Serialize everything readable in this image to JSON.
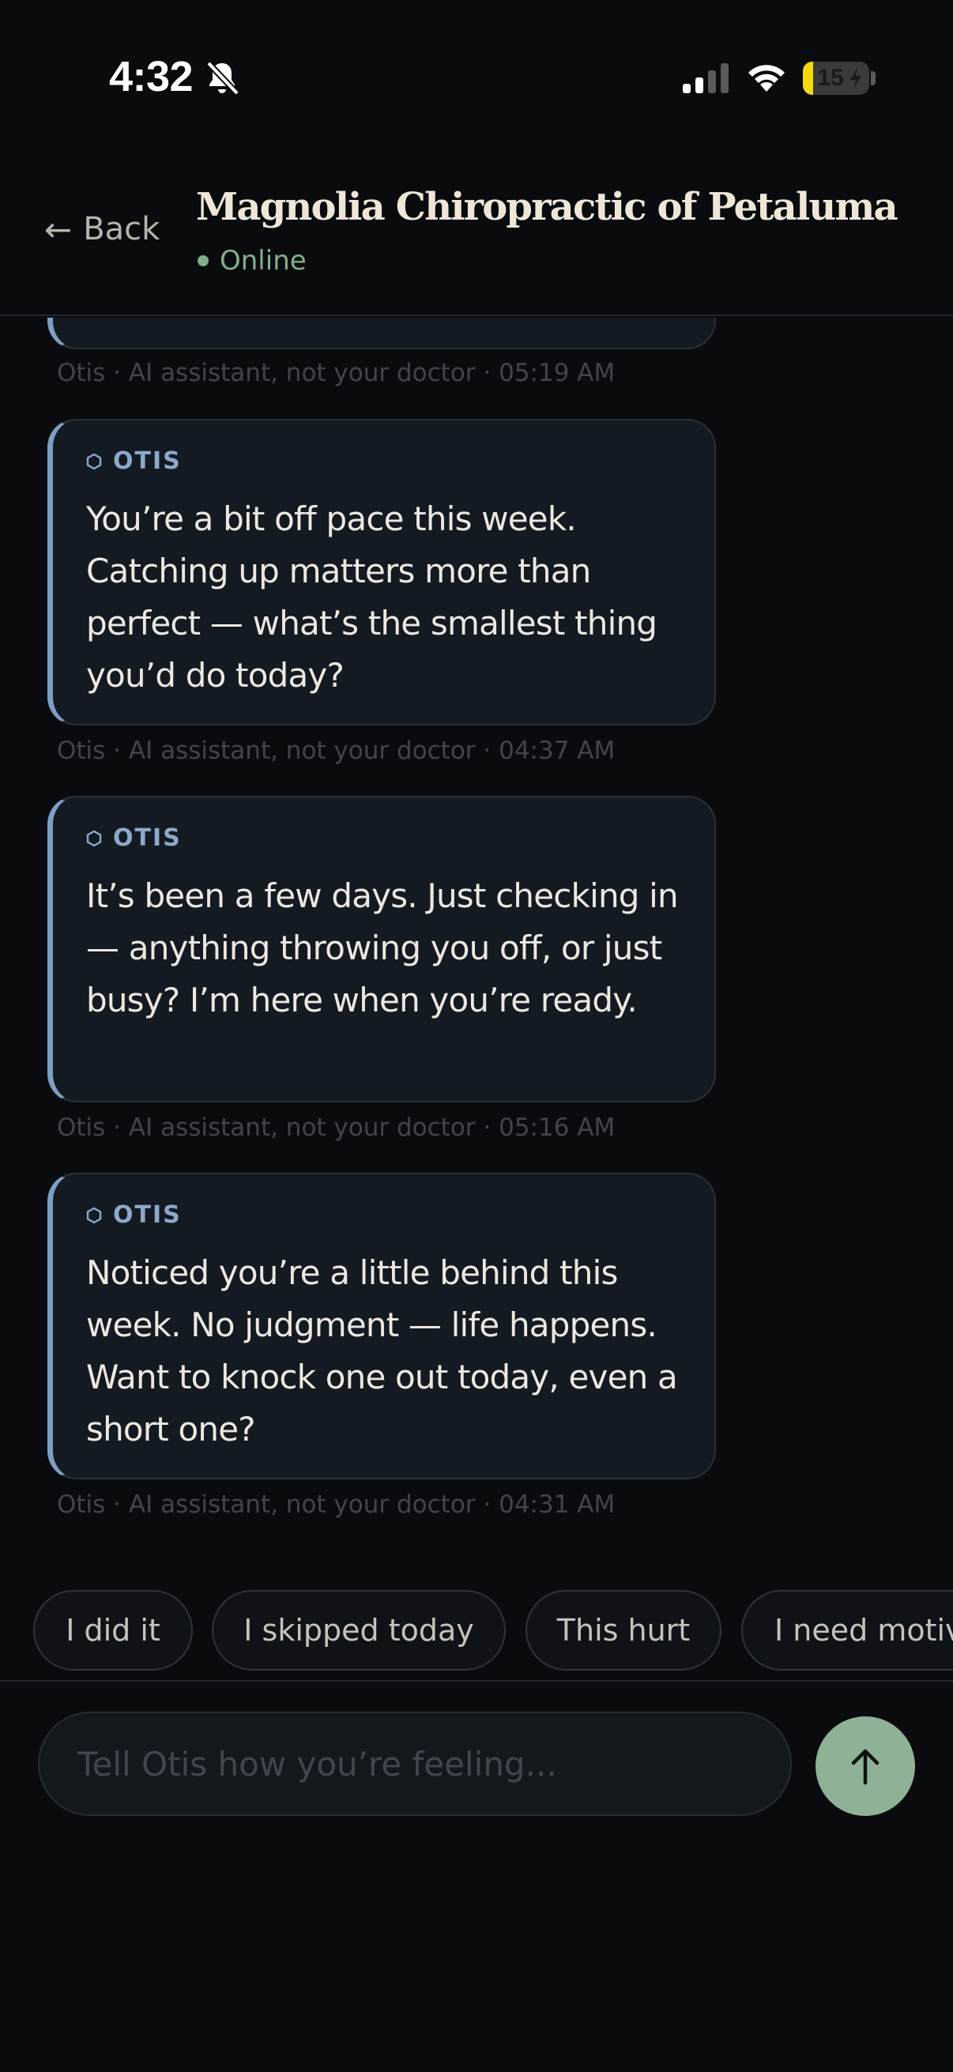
{
  "status_bar": {
    "time": "4:32",
    "battery_level": "15",
    "battery_fill_fraction": 0.15
  },
  "header": {
    "back_label": "Back",
    "back_arrow": "←",
    "title": "Magnolia Chiropractic of Petaluma",
    "presence": "Online"
  },
  "messages": {
    "partial_meta": "Otis · AI assistant, not your doctor · 05:19 AM",
    "items": [
      {
        "sender": "OTIS",
        "text": "You’re a bit off pace this week. Catching up matters more than perfect — what’s the smallest thing you’d do today?",
        "meta": "Otis · AI assistant, not your doctor · 04:37 AM"
      },
      {
        "sender": "OTIS",
        "text": "It’s been a few days. Just checking in — anything throwing you off, or just busy? I’m here when you’re ready.",
        "meta": "Otis · AI assistant, not your doctor · 05:16 AM"
      },
      {
        "sender": "OTIS",
        "text": "Noticed you’re a little behind this week. No judgment — life happens. Want to knock one out today, even a short one?",
        "meta": "Otis · AI assistant, not your doctor · 04:31 AM"
      }
    ]
  },
  "quick_replies": [
    "I did it",
    "I skipped today",
    "This hurt",
    "I need motivation"
  ],
  "composer": {
    "placeholder": "Tell Otis how you’re feeling..."
  },
  "colors": {
    "accent_blue": "#7c9fc6",
    "online_green": "#7fb08a",
    "send_green": "#8fb196",
    "battery_yellow": "#f5d90a"
  },
  "icons": {
    "mute": "bell-slash-icon",
    "signal": "cellular-signal-icon",
    "wifi": "wifi-icon",
    "charging": "bolt-icon",
    "sender": "hexagon-icon",
    "send": "arrow-up-icon"
  }
}
